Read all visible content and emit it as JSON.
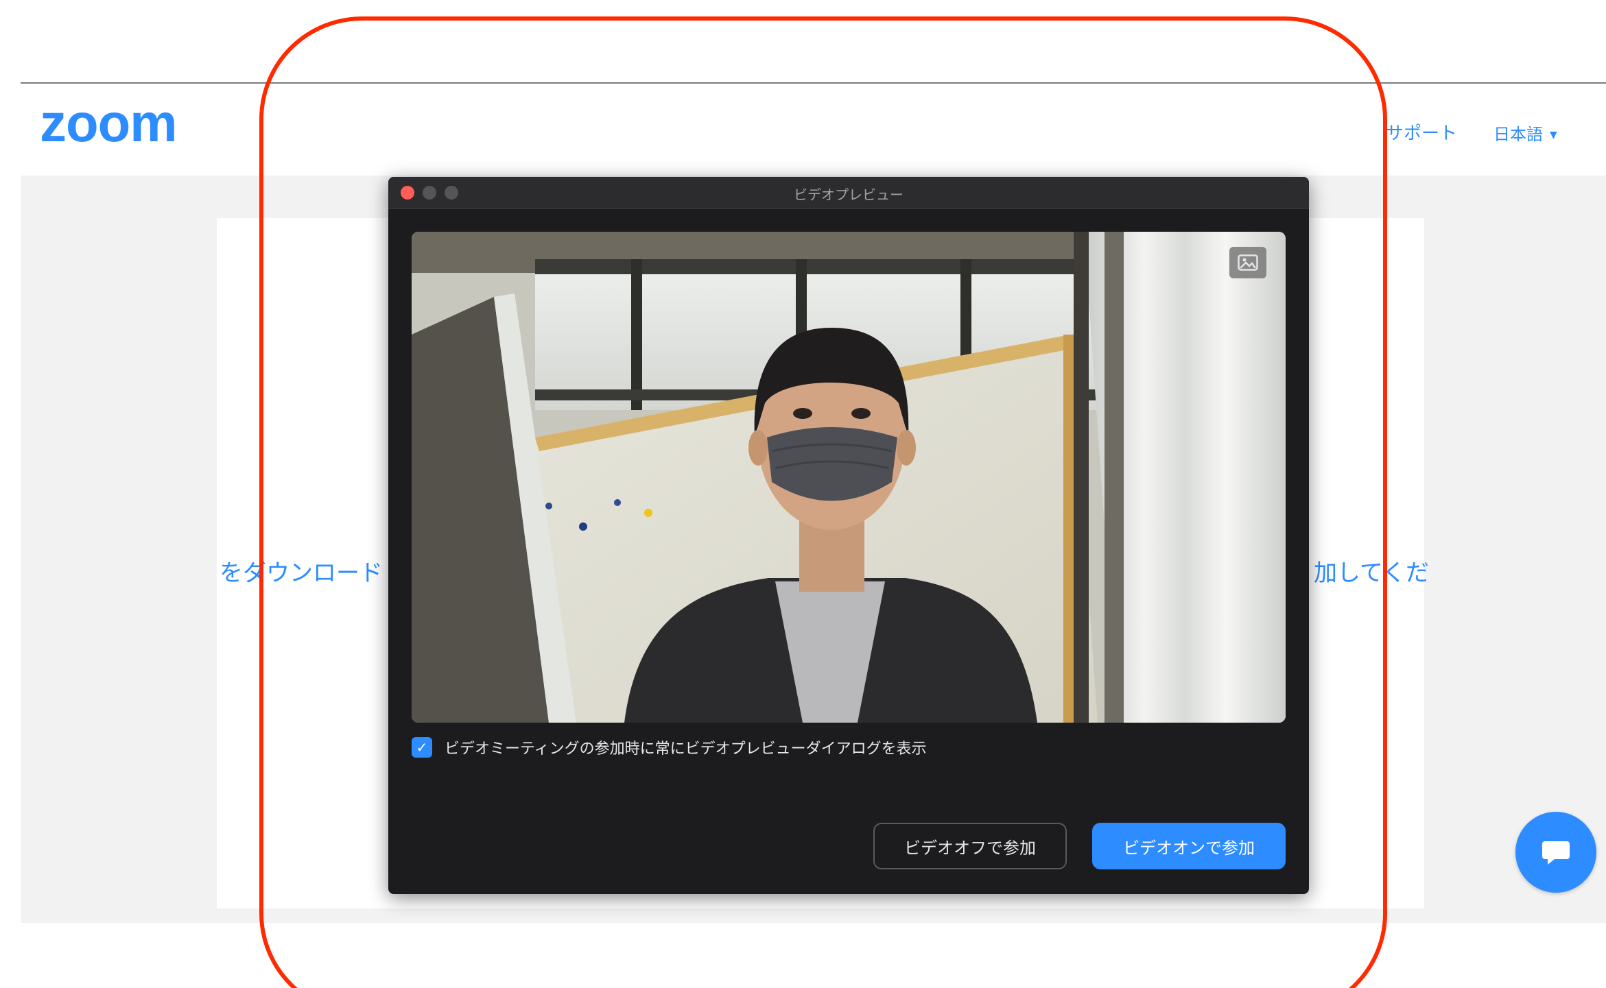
{
  "header": {
    "logo_text": "zoom",
    "nav": {
      "support": "サポート",
      "language": "日本語"
    }
  },
  "background": {
    "left_text": "をダウンロード",
    "right_text": "加してくだ"
  },
  "dialog": {
    "title": "ビデオプレビュー",
    "checkbox": {
      "label": "ビデオミーティングの参加時に常にビデオプレビューダイアログを表示",
      "checked": true
    },
    "buttons": {
      "join_video_off": "ビデオオフで参加",
      "join_video_on": "ビデオオンで参加"
    }
  },
  "colors": {
    "brand_blue": "#2d8cff",
    "annotation_red": "#ff2a00",
    "dialog_bg": "#1c1c1e"
  },
  "icons": {
    "background_toggle": "image-icon",
    "chat": "chat-bubble-icon",
    "checkbox_mark": "checkmark-icon"
  }
}
